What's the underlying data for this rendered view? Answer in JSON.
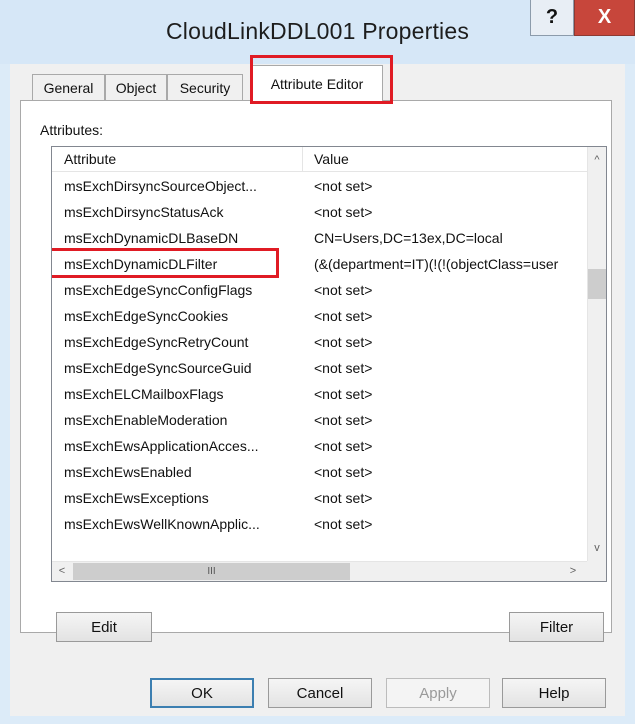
{
  "window": {
    "title": "CloudLinkDDL001 Properties",
    "help_label": "?",
    "close_label": "X"
  },
  "tabs": [
    {
      "label": "General"
    },
    {
      "label": "Object"
    },
    {
      "label": "Security"
    },
    {
      "label": "Attribute Editor",
      "active": true
    }
  ],
  "attributes_label": "Attributes:",
  "columns": {
    "attribute": "Attribute",
    "value": "Value"
  },
  "rows": [
    {
      "attribute": "msExchDirsyncSourceObject...",
      "value": "<not set>"
    },
    {
      "attribute": "msExchDirsyncStatusAck",
      "value": "<not set>"
    },
    {
      "attribute": "msExchDynamicDLBaseDN",
      "value": "CN=Users,DC=13ex,DC=local"
    },
    {
      "attribute": "msExchDynamicDLFilter",
      "value": "(&(department=IT)(!(!(objectClass=user"
    },
    {
      "attribute": "msExchEdgeSyncConfigFlags",
      "value": "<not set>"
    },
    {
      "attribute": "msExchEdgeSyncCookies",
      "value": "<not set>"
    },
    {
      "attribute": "msExchEdgeSyncRetryCount",
      "value": "<not set>"
    },
    {
      "attribute": "msExchEdgeSyncSourceGuid",
      "value": "<not set>"
    },
    {
      "attribute": "msExchELCMailboxFlags",
      "value": "<not set>"
    },
    {
      "attribute": "msExchEnableModeration",
      "value": "<not set>"
    },
    {
      "attribute": "msExchEwsApplicationAcces...",
      "value": "<not set>"
    },
    {
      "attribute": "msExchEwsEnabled",
      "value": "<not set>"
    },
    {
      "attribute": "msExchEwsExceptions",
      "value": "<not set>"
    },
    {
      "attribute": "msExchEwsWellKnownApplic...",
      "value": "<not set>"
    }
  ],
  "scrollbar": {
    "up_arrow": "^",
    "down_arrow": "v",
    "left_arrow": "<",
    "right_arrow": ">",
    "thumb_grip": "III"
  },
  "buttons": {
    "edit": "Edit",
    "filter": "Filter",
    "ok": "OK",
    "cancel": "Cancel",
    "apply": "Apply",
    "help": "Help"
  },
  "colors": {
    "highlight": "#e01b24",
    "close_button": "#c7463b",
    "titlebar": "#d6e7f7"
  }
}
